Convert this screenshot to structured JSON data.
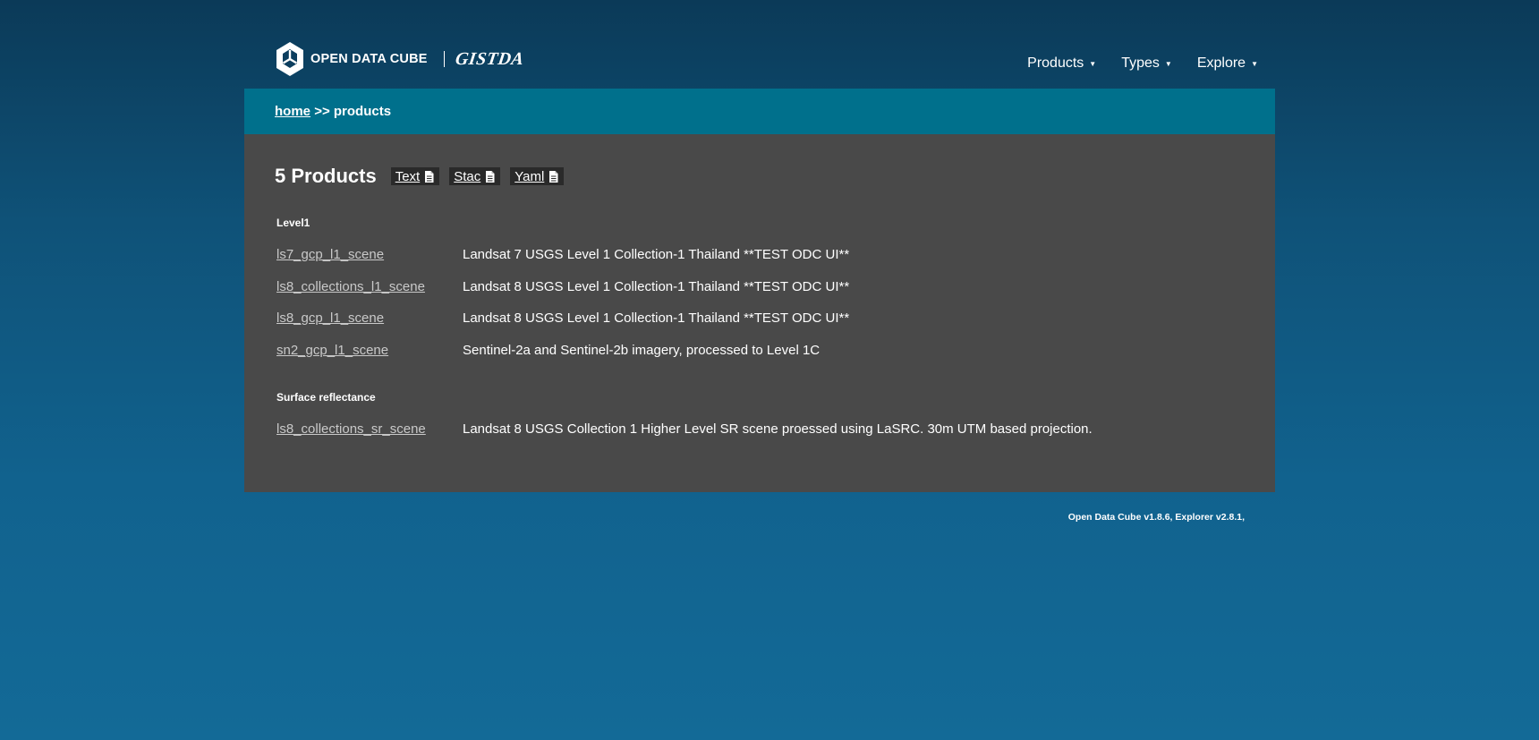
{
  "logo": {
    "text": "OPEN DATA CUBE",
    "partner": "GISTDA"
  },
  "nav": {
    "items": [
      {
        "label": "Products"
      },
      {
        "label": "Types"
      },
      {
        "label": "Explore"
      }
    ]
  },
  "breadcrumb": {
    "home": "home",
    "separator": ">>",
    "current": "products"
  },
  "main": {
    "title": "5 Products",
    "formats": [
      {
        "label": "Text"
      },
      {
        "label": "Stac"
      },
      {
        "label": "Yaml"
      }
    ],
    "groups": [
      {
        "title": "Level1",
        "products": [
          {
            "name": "ls7_gcp_l1_scene",
            "description": "Landsat 7 USGS Level 1 Collection-1 Thailand **TEST ODC UI**"
          },
          {
            "name": "ls8_collections_l1_scene",
            "description": "Landsat 8 USGS Level 1 Collection-1 Thailand **TEST ODC UI**"
          },
          {
            "name": "ls8_gcp_l1_scene",
            "description": "Landsat 8 USGS Level 1 Collection-1 Thailand **TEST ODC UI**"
          },
          {
            "name": "sn2_gcp_l1_scene",
            "description": "Sentinel-2a and Sentinel-2b imagery, processed to Level 1C"
          }
        ]
      },
      {
        "title": "Surface reflectance",
        "products": [
          {
            "name": "ls8_collections_sr_scene",
            "description": "Landsat 8 USGS Collection 1 Higher Level SR scene proessed using LaSRC. 30m UTM based projection."
          }
        ]
      }
    ]
  },
  "footer": {
    "text": "Open Data Cube v1.8.6, Explorer v2.8.1,"
  },
  "colors": {
    "breadcrumb_bar": "#00708c",
    "content_bg": "#494949",
    "link": "#c9c9c9"
  },
  "icons": {
    "logo": "cube-logo-icon",
    "caret": "caret-down-icon",
    "format": "document-icon"
  }
}
